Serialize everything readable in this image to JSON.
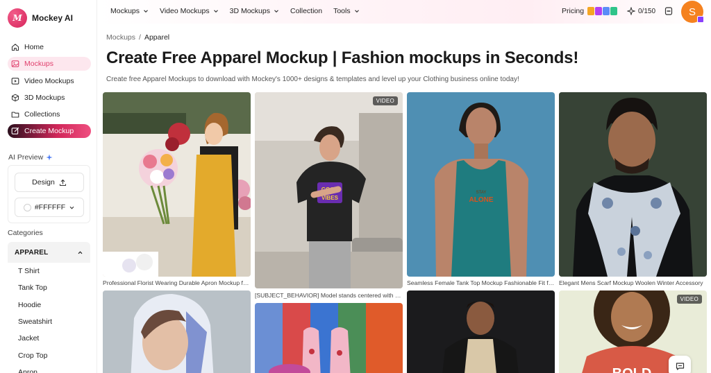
{
  "brand": {
    "name": "Mockey AI",
    "logo_letters": "M"
  },
  "sidebar": {
    "items": [
      {
        "label": "Home",
        "icon": "home-icon"
      },
      {
        "label": "Mockups",
        "icon": "image-icon"
      },
      {
        "label": "Video Mockups",
        "icon": "video-icon"
      },
      {
        "label": "3D Mockups",
        "icon": "cube-icon"
      },
      {
        "label": "Collections",
        "icon": "folder-icon"
      },
      {
        "label": "Create Mockup",
        "icon": "edit-icon"
      }
    ],
    "ai_preview": {
      "label": "AI Preview",
      "design_label": "Design",
      "color_value": "#FFFFFF"
    },
    "categories_label": "Categories",
    "category_group": "APPAREL",
    "category_items": [
      "T Shirt",
      "Tank Top",
      "Hoodie",
      "Sweatshirt",
      "Jacket",
      "Crop Top",
      "Apron"
    ]
  },
  "topnav": {
    "menu": [
      "Mockups",
      "Video Mockups",
      "3D Mockups",
      "Collection",
      "Tools"
    ],
    "pricing": "Pricing",
    "credits": "0/150",
    "avatar_letter": "S"
  },
  "main": {
    "breadcrumb": [
      "Mockups",
      "Apparel"
    ],
    "title": "Create Free Apparel Mockup | Fashion mockups in Seconds!",
    "subtitle": "Create free Apparel Mockups to download with Mockey's 1000+ designs & templates and level up your Clothing business online today!",
    "video_badge": "VIDEO",
    "cards": [
      {
        "caption": "Professional Florist Wearing Durable Apron Mockup for Business",
        "video": false
      },
      {
        "caption": "[SUBJECT_BEHAVIOR] Model stands centered with arms raised",
        "video": true
      },
      {
        "caption": "Seamless Female Tank Top Mockup Fashionable Fit for Summer",
        "video": false
      },
      {
        "caption": "Elegant Mens Scarf Mockup Woolen Winter Accessory",
        "video": false
      }
    ]
  },
  "colors": {
    "accent": "#e0406d",
    "avatar": "#f5821f"
  }
}
